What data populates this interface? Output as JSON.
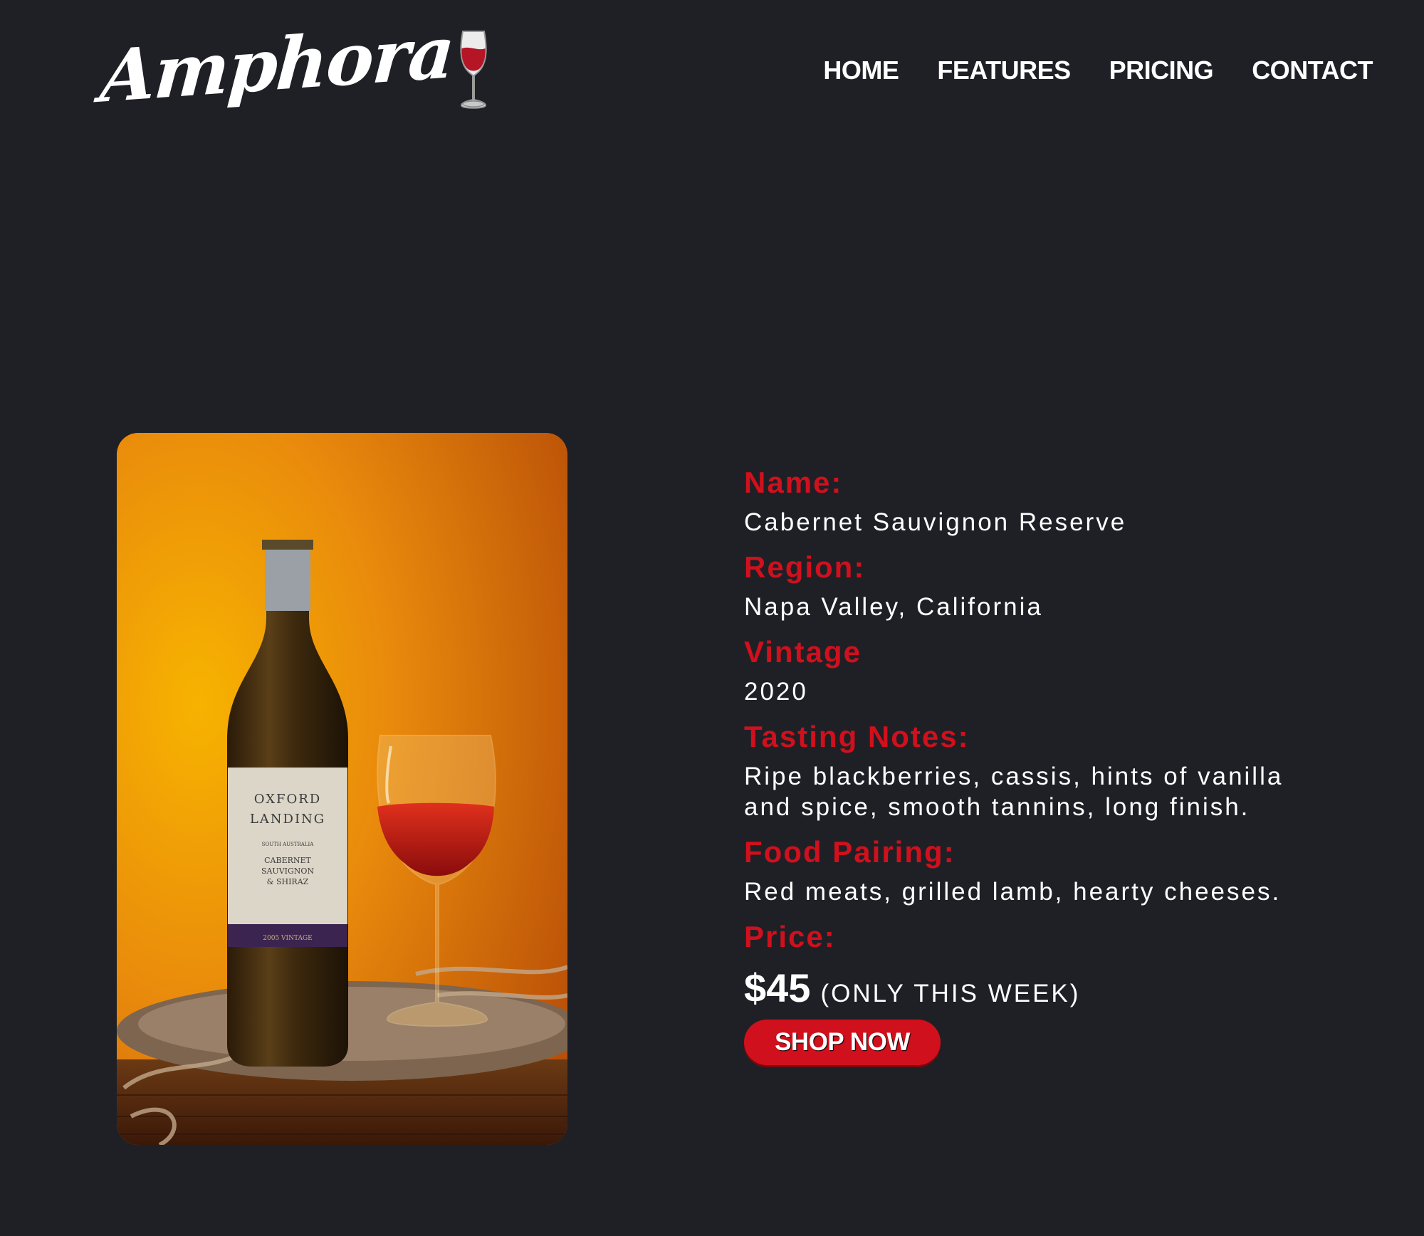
{
  "brand": {
    "name": "Amphora",
    "wine_color": "#b41626"
  },
  "nav": {
    "items": [
      {
        "label": "HOME"
      },
      {
        "label": "FEATURES"
      },
      {
        "label": "PRICING"
      },
      {
        "label": "CONTACT"
      }
    ]
  },
  "product_image": {
    "bottle_label": {
      "line1": "OXFORD",
      "line2": "LANDING",
      "region": "SOUTH AUSTRALIA",
      "variety1": "CABERNET",
      "variety2": "SAUVIGNON",
      "variety3": "& SHIRAZ",
      "vintage": "2005 VINTAGE"
    }
  },
  "details": {
    "name_label": "Name:",
    "name_value": "Cabernet Sauvignon Reserve",
    "region_label": "Region:",
    "region_value": "Napa Valley, California",
    "vintage_label": "Vintage",
    "vintage_value": "2020",
    "tasting_label": "Tasting Notes:",
    "tasting_value": "Ripe blackberries, cassis, hints of vanilla and spice, smooth tannins, long finish.",
    "food_label": "Food Pairing:",
    "food_value": "Red meats, grilled lamb, hearty cheeses.",
    "price_label": "Price:",
    "price_amount": "$45",
    "price_note": "(ONLY THIS WEEK)",
    "shop_label": "SHOP NOW"
  },
  "colors": {
    "background": "#1f2026",
    "accent": "#d0101c",
    "text": "#ffffff"
  }
}
